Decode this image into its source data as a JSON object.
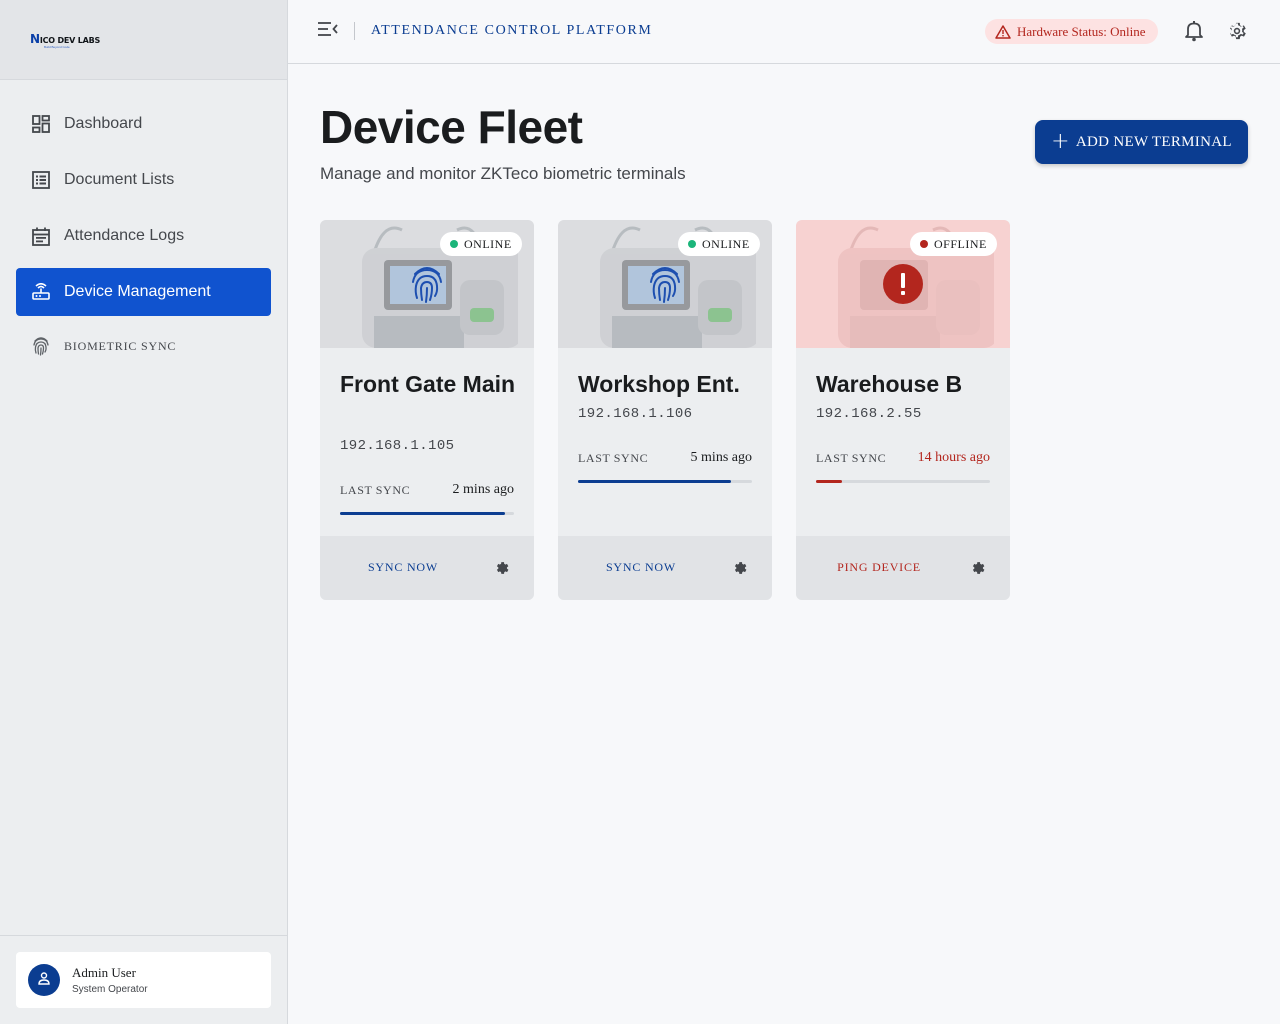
{
  "logo": {
    "text_n": "N",
    "text_rest": "ICO DEV LABS",
    "tagline": "Build Beyond Code"
  },
  "sidebar": {
    "items": [
      {
        "label": "Dashboard",
        "icon": "dashboard-icon"
      },
      {
        "label": "Document Lists",
        "icon": "list-icon"
      },
      {
        "label": "Attendance Logs",
        "icon": "calendar-icon"
      },
      {
        "label": "Device Management",
        "icon": "router-icon",
        "active": true
      },
      {
        "label": "BIOMETRIC SYNC",
        "icon": "fingerprint-icon"
      }
    ],
    "user": {
      "name": "Admin User",
      "role": "System Operator"
    }
  },
  "header": {
    "title": "ATTENDANCE CONTROL PLATFORM",
    "hardware_status": "Hardware Status: Online"
  },
  "main": {
    "title": "Device Fleet",
    "subtitle": "Manage and monitor ZKTeco biometric terminals",
    "add_button": "ADD NEW TERMINAL"
  },
  "devices": [
    {
      "name": "Front Gate Main",
      "ip": "192.168.1.105",
      "status": "ONLINE",
      "sync_label": "LAST SYNC",
      "last_sync": "2 mins ago",
      "sync_progress": 0.95,
      "action": "SYNC NOW"
    },
    {
      "name": "Workshop Ent.",
      "ip": "192.168.1.106",
      "status": "ONLINE",
      "sync_label": "LAST SYNC",
      "last_sync": "5 mins ago",
      "sync_progress": 0.88,
      "action": "SYNC NOW"
    },
    {
      "name": "Warehouse B",
      "ip": "192.168.2.55",
      "status": "OFFLINE",
      "sync_label": "LAST SYNC",
      "last_sync": "14 hours ago",
      "sync_progress": 0.15,
      "action": "PING DEVICE"
    }
  ],
  "colors": {
    "primary": "#0b3d91",
    "active_nav": "#1053cf",
    "online": "#1bb57a",
    "offline": "#b3261e"
  }
}
